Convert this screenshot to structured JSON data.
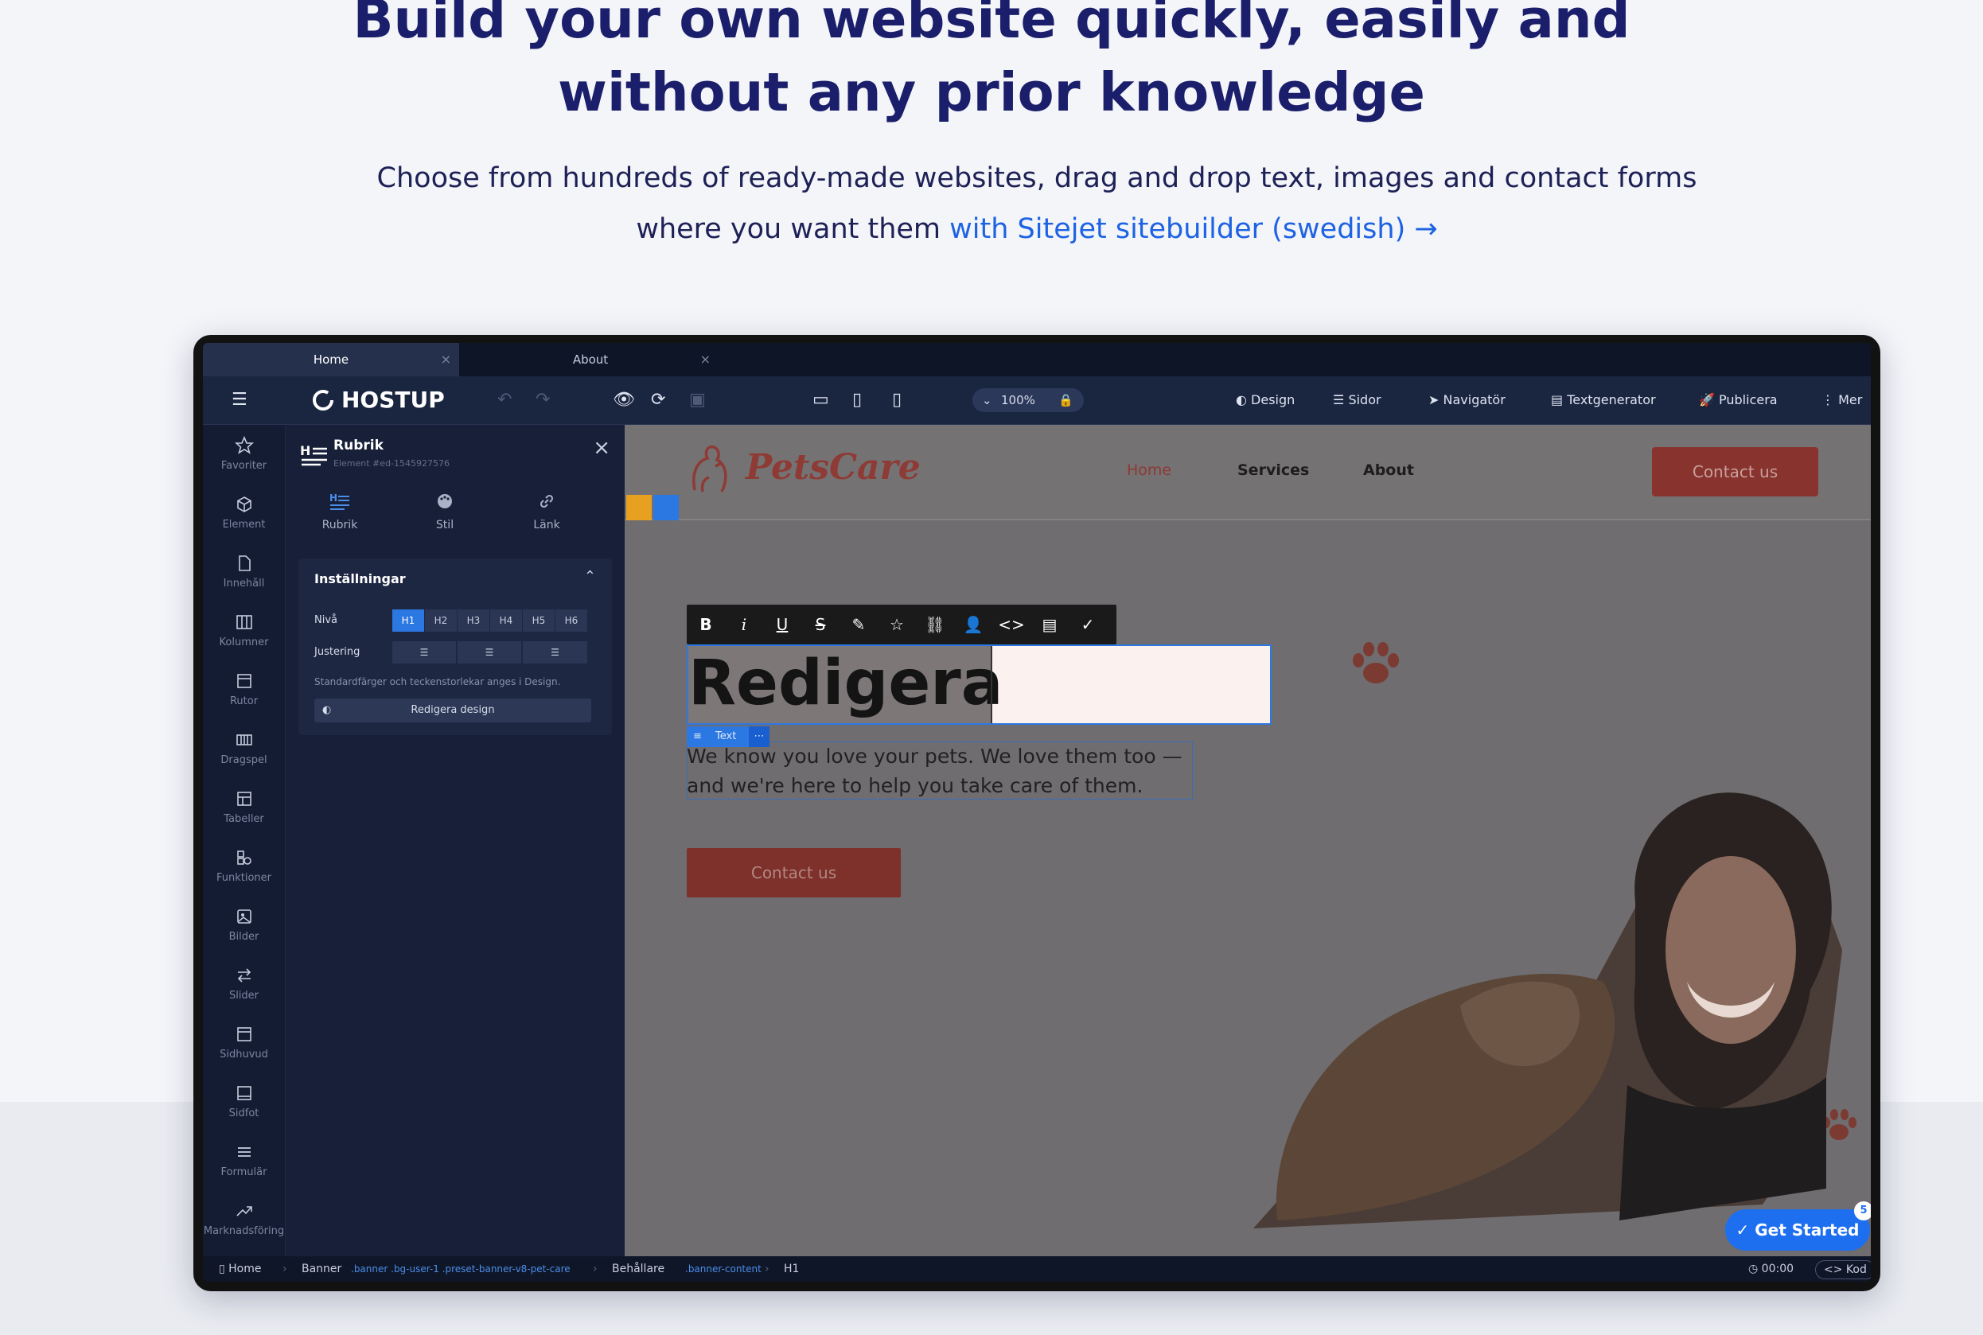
{
  "hero": {
    "title_line1": "Build your own website quickly, easily and",
    "title_line2": "without any prior knowledge",
    "subtitle_line1": "Choose from hundreds of ready-made websites, drag and drop text, images and contact forms",
    "subtitle_line2_prefix": "where you want them",
    "link_text": "with Sitejet sitebuilder (swedish) →"
  },
  "editor": {
    "tabs": [
      {
        "label": "Home",
        "active": true
      },
      {
        "label": "About",
        "active": false
      }
    ],
    "brand": "HOSTUP",
    "zoom": "100%",
    "toolbar_links": [
      "Design",
      "Sidor",
      "Navigatör",
      "Textgenerator",
      "Publicera",
      "Mer"
    ],
    "left_items": [
      "Favoriter",
      "Element",
      "Innehåll",
      "Kolumner",
      "Rutor",
      "Dragspel",
      "Tabeller",
      "Funktioner",
      "Bilder",
      "Slider",
      "Sidhuvud",
      "Sidfot",
      "Formulär",
      "Marknadsföring"
    ],
    "panel": {
      "title": "Rubrik",
      "subtitle": "Element #ed-1545927576",
      "tabs": [
        "Rubrik",
        "Stil",
        "Länk"
      ],
      "section": "Inställningar",
      "level_label": "Nivå",
      "levels": [
        "H1",
        "H2",
        "H3",
        "H4",
        "H5",
        "H6"
      ],
      "align_label": "Justering",
      "note": "Standardfärger och teckenstorlekar anges i Design.",
      "edit_design": "Redigera design"
    },
    "status": {
      "home": "Home",
      "banner": "Banner",
      "banner_classes": ".banner .bg-user-1 .preset-banner-v8-pet-care",
      "container": "Behållare",
      "container_class": ".banner-content",
      "tag": "H1",
      "time": "00:00",
      "code": "Kod"
    }
  },
  "site": {
    "brand": "PetsCare",
    "nav": [
      "Home",
      "Services",
      "About"
    ],
    "contact_btn": "Contact us",
    "heading": "Redigera",
    "text_tag": "Text",
    "paragraph_line1": "We know you love your pets. We love them too —",
    "paragraph_line2": "and we're here to help you take care of them.",
    "cta": "Contact us"
  },
  "widget": {
    "label": "Get Started",
    "count": "5"
  },
  "colors": {
    "hero_title": "#1b1f6b",
    "link": "#1d63e3",
    "editor_bg": "#131c33",
    "accent": "#2c78e3",
    "brand_red": "#8e3a35"
  }
}
